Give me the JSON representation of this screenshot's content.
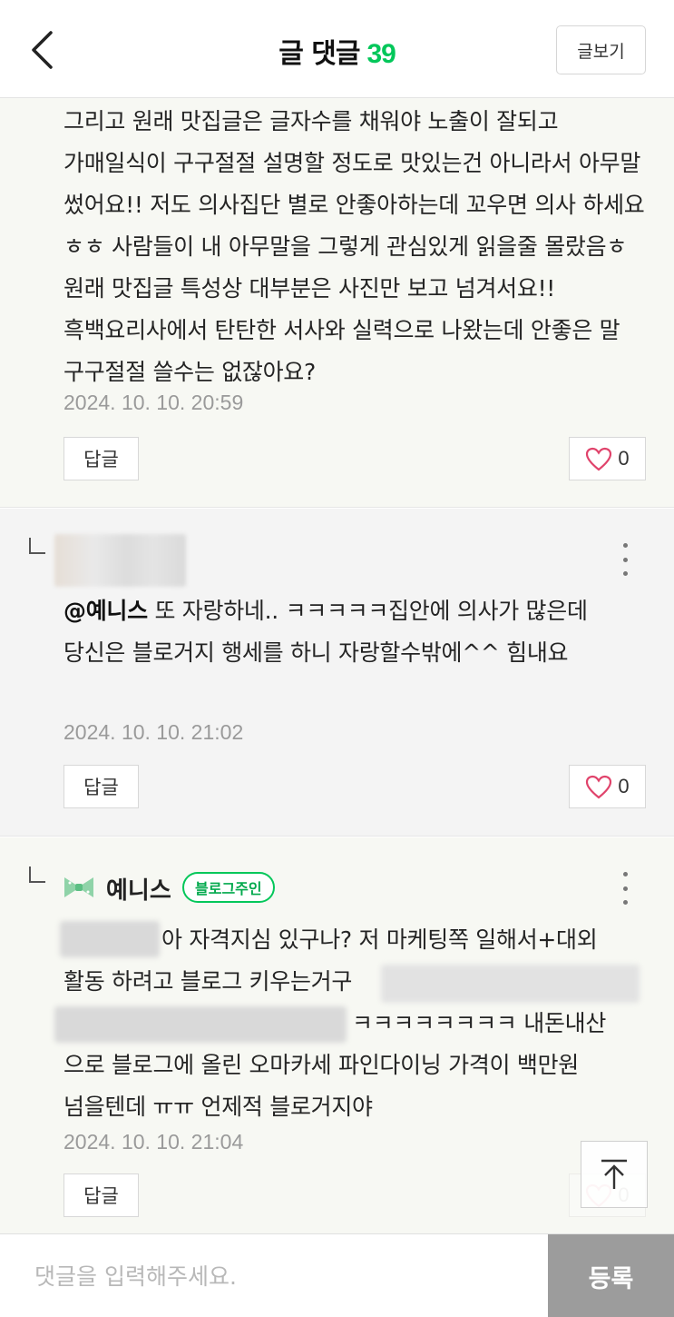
{
  "header": {
    "title": "글 댓글",
    "count": "39",
    "view_post_label": "글보기"
  },
  "comments": [
    {
      "text": "그리고 원래 맛집글은 글자수를 채워야 노출이 잘되고 가매일식이 구구절절 설명할 정도로 맛있는건 아니라서 아무말 썼어요!! 저도 의사집단 별로 안좋아하는데 꼬우면 의사 하세요 ㅎㅎ 사람들이 내 아무말을 그렇게 관심있게 읽을줄 몰랐음ㅎ 원래 맛집글 특성상 대부분은 사진만 보고 넘겨서요!! 흑백요리사에서 탄탄한 서사와 실력으로 나왔는데 안좋은 말 구구절절 쓸수는 없잖아요?",
      "timestamp": "2024. 10. 10. 20:59",
      "reply_label": "답글",
      "likes": "0"
    },
    {
      "mention": "@예니스",
      "text": " 또 자랑하네.. ㅋㅋㅋㅋㅋ집안에 의사가 많은데 당신은  블로거지 행세를 하니 자랑할수밖에^^ 힘내요",
      "timestamp": "2024. 10. 10. 21:02",
      "reply_label": "답글",
      "likes": "0"
    },
    {
      "author": "예니스",
      "badge": "블로그주인",
      "line1": "아 자격지심 있구나? 저 마케팅쪽 일해서+대외",
      "line2": "활동 하려고 블로그 키우는거구",
      "line3": "ㅋㅋㅋㅋㅋㅋㅋㅋ 내돈내산",
      "line4": "으로 블로그에 올린 오마카세 파인다이닝 가격이 백만원",
      "line5": "넘을텐데 ㅠㅠ 언제적 블로거지야",
      "timestamp": "2024. 10. 10. 21:04",
      "reply_label": "답글",
      "likes": "0"
    }
  ],
  "input": {
    "placeholder": "댓글을 입력해주세요.",
    "submit_label": "등록"
  },
  "colors": {
    "accent": "#03c75a",
    "submit_bg": "#9c9c9c",
    "heart": "#e0436b"
  },
  "icons": [
    "back-arrow-icon",
    "heart-icon",
    "more-vertical-icon",
    "reply-arrow-icon",
    "scroll-top-icon",
    "author-bowtie-icon"
  ]
}
